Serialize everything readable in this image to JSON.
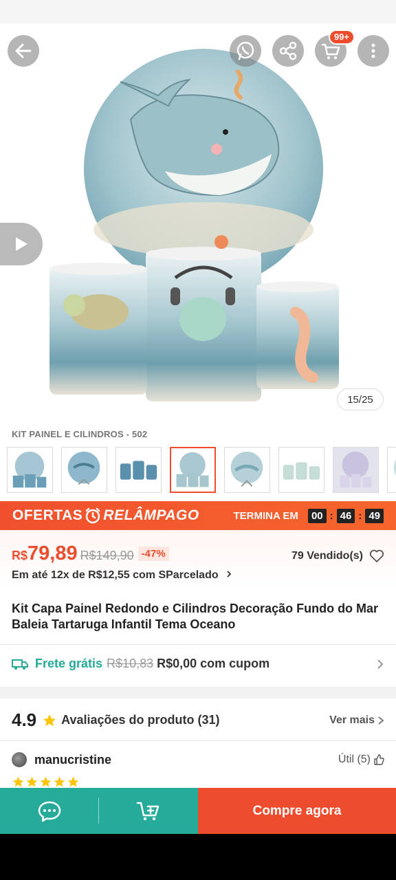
{
  "header": {
    "back_icon": "arrow-left-icon",
    "whatsapp_icon": "whatsapp-icon",
    "share_icon": "share-icon",
    "cart_icon": "cart-icon",
    "cart_badge": "99+",
    "more_icon": "more-vertical-icon"
  },
  "gallery": {
    "play_icon": "play-icon",
    "counter": "15/25",
    "variant_label": "KIT PAINEL E CILINDROS - 502",
    "thumb_count": 8,
    "active_thumb": 3
  },
  "flash_sale": {
    "label_part1": "OFERTAS",
    "label_part2": "RELÂMPAGO",
    "ends_label": "TERMINA EM",
    "hours": "00",
    "minutes": "46",
    "seconds": "49",
    "sep": ":"
  },
  "price": {
    "currency": "R$",
    "current": "79,89",
    "original": "R$149,90",
    "discount": "-47%",
    "sold": "79 Vendido(s)",
    "installments": "Em até 12x de R$12,55 com SParcelado"
  },
  "product": {
    "title": "Kit Capa Painel Redondo e Cilindros Decoração Fundo do Mar Baleia Tartaruga Infantil Tema Oceano"
  },
  "shipping": {
    "free_label": "Frete grátis",
    "old_price": "R$10,83",
    "coupon_text": "R$0,00 com cupom"
  },
  "ratings": {
    "score": "4.9",
    "label": "Avaliações do produto (31)",
    "see_more": "Ver mais",
    "review": {
      "user": "manucristine",
      "useful": "Útil (5)",
      "stars": 5
    }
  },
  "bottom": {
    "chat_icon": "chat-icon",
    "add_cart_icon": "add-to-cart-icon",
    "buy_now": "Compre agora"
  },
  "colors": {
    "brand": "#ee4d2d",
    "teal": "#26aa99"
  }
}
